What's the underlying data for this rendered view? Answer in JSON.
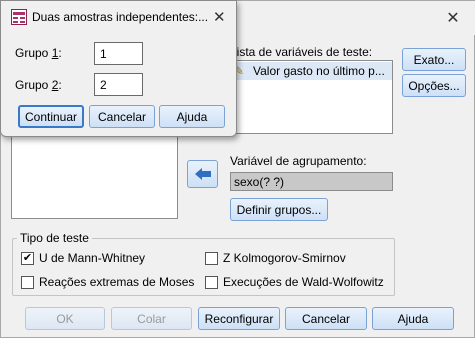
{
  "main": {
    "test_vars_label": "Lista de variáveis de teste:",
    "test_var_item": "Valor gasto no último p...",
    "grouping_label": "Variável de agrupamento:",
    "grouping_value": "sexo(? ?)",
    "define_groups": "Definir grupos...",
    "exact": "Exato...",
    "options": "Opções...",
    "test_type_legend": "Tipo de teste",
    "tests": [
      {
        "label": "U de Mann-Whitney",
        "checked": true
      },
      {
        "label": "Z Kolmogorov-Smirnov",
        "checked": false
      },
      {
        "label": "Reações extremas de Moses",
        "checked": false
      },
      {
        "label": "Execuções de Wald-Wolfowitz",
        "checked": false
      }
    ],
    "buttons": {
      "ok": "OK",
      "paste": "Colar",
      "reset": "Reconfigurar",
      "cancel": "Cancelar",
      "help": "Ajuda"
    }
  },
  "sub": {
    "title": "Duas amostras independentes:...",
    "close": "✕",
    "group1_label": "Grupo 1:",
    "group1_value": "1",
    "group2_label": "Grupo 2:",
    "group2_value": "2",
    "continue": "Continuar",
    "cancel": "Cancelar",
    "help": "Ajuda"
  },
  "colors": {
    "button_border": "#7aa2d6",
    "arrow_blue": "#2f6fbf"
  }
}
